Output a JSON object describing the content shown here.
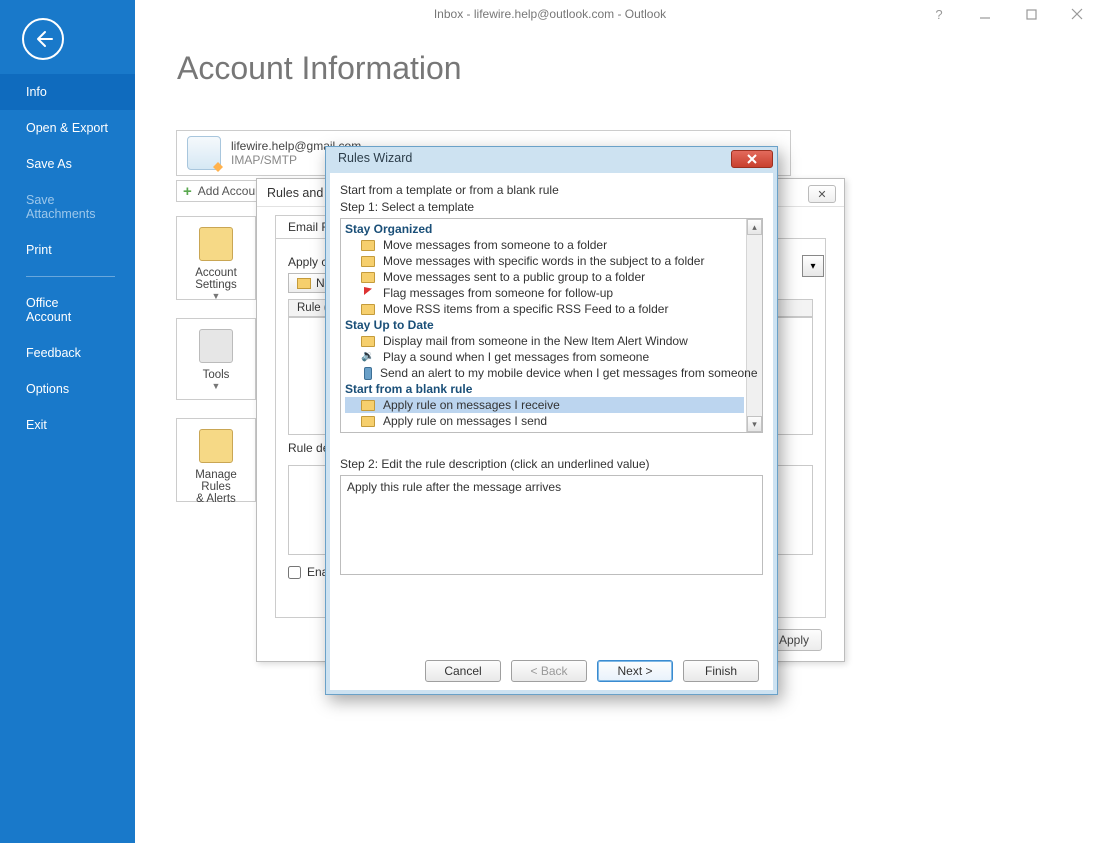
{
  "window": {
    "title": "Inbox - lifewire.help@outlook.com  -  Outlook",
    "help": "?"
  },
  "sidebar": {
    "items": [
      {
        "label": "Info",
        "active": true
      },
      {
        "label": "Open & Export"
      },
      {
        "label": "Save As"
      },
      {
        "label": "Save Attachments",
        "disabled": true
      },
      {
        "label": "Print"
      },
      {
        "label": "Office Account",
        "sepBefore": true
      },
      {
        "label": "Feedback"
      },
      {
        "label": "Options"
      },
      {
        "label": "Exit"
      }
    ]
  },
  "page": {
    "title": "Account Information",
    "account_email": "lifewire.help@gmail.com",
    "account_type": "IMAP/SMTP",
    "add_account": "Add Account",
    "panels": {
      "account_settings": "Account\nSettings",
      "tools": "Tools",
      "manage_rules": "Manage Rules\n& Alerts"
    }
  },
  "rules_dlg": {
    "title": "Rules and Alerts",
    "close": "✕",
    "tab_email": "Email Rules",
    "apply_changes": "Apply changes to this folder:",
    "new_rule": "New Rule…",
    "col_rule": "Rule (applied in the order shown)",
    "rule_desc_label": "Rule description (click an underlined value to edit):",
    "enable_label": "Enable rules on all messages downloaded from RSS Feeds",
    "apply": "Apply"
  },
  "wizard": {
    "title": "Rules Wizard",
    "start_line": "Start from a template or from a blank rule",
    "step1_label": "Step 1: Select a template",
    "groups": [
      {
        "heading": "Stay Organized",
        "items": [
          {
            "icon": "folder",
            "label": "Move messages from someone to a folder"
          },
          {
            "icon": "folder",
            "label": "Move messages with specific words in the subject to a folder"
          },
          {
            "icon": "folder",
            "label": "Move messages sent to a public group to a folder"
          },
          {
            "icon": "flag",
            "label": "Flag messages from someone for follow-up"
          },
          {
            "icon": "folder",
            "label": "Move RSS items from a specific RSS Feed to a folder"
          }
        ]
      },
      {
        "heading": "Stay Up to Date",
        "items": [
          {
            "icon": "folder",
            "label": "Display mail from someone in the New Item Alert Window"
          },
          {
            "icon": "sound",
            "label": "Play a sound when I get messages from someone"
          },
          {
            "icon": "phone",
            "label": "Send an alert to my mobile device when I get messages from someone"
          }
        ]
      },
      {
        "heading": "Start from a blank rule",
        "items": [
          {
            "icon": "folder",
            "label": "Apply rule on messages I receive",
            "selected": true
          },
          {
            "icon": "folder",
            "label": "Apply rule on messages I send"
          }
        ]
      }
    ],
    "step2_label": "Step 2: Edit the rule description (click an underlined value)",
    "step2_text": "Apply this rule after the message arrives",
    "buttons": {
      "cancel": "Cancel",
      "back": "< Back",
      "next": "Next >",
      "finish": "Finish"
    }
  }
}
